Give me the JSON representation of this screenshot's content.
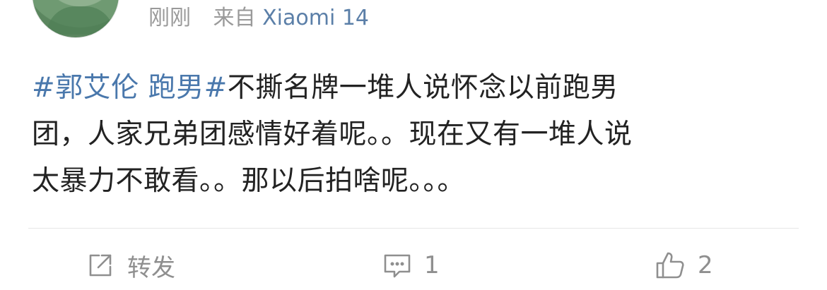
{
  "post": {
    "time": "刚刚",
    "source_prefix": "来自",
    "device": "Xiaomi 14",
    "topic": "#郭艾伦 跑男#",
    "line1_rest": "不撕名牌一堆人说怀念以前跑男",
    "line2": "团，人家兄弟团感情好着呢。。现在又有一堆人说",
    "line3": "太暴力不敢看。。那以后拍啥呢。。。"
  },
  "actions": {
    "repost_label": "转发",
    "comment_count": "1",
    "like_count": "2"
  },
  "colors": {
    "topic": "#4a78ac",
    "meta": "#9a9a9a",
    "device": "#5b7fa8",
    "action": "#8f8f8f"
  },
  "icons": [
    "repost-icon",
    "comment-icon",
    "like-icon"
  ]
}
